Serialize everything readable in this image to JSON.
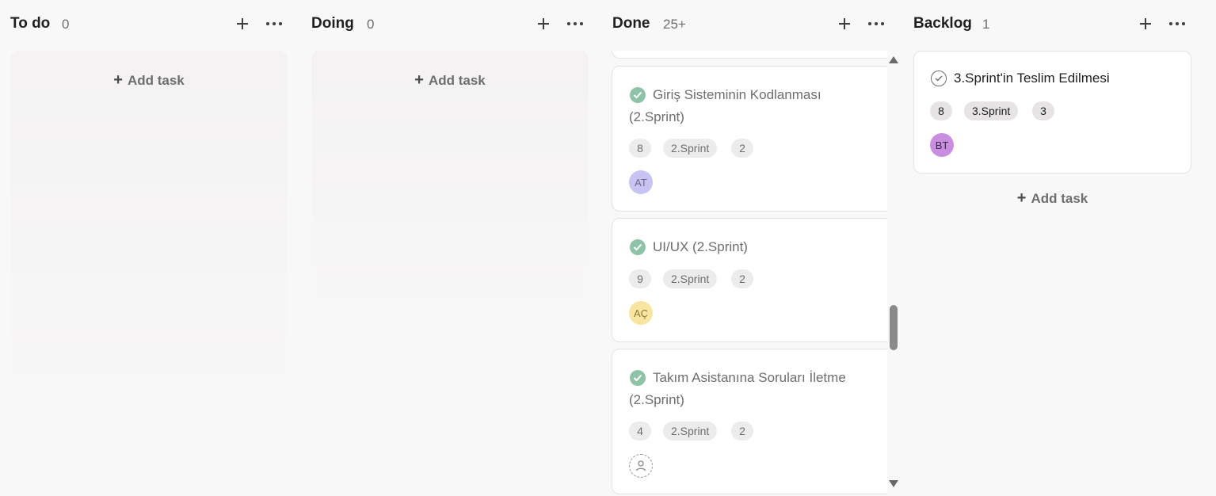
{
  "columns": [
    {
      "title": "To do",
      "count": "0",
      "add_task": "Add task"
    },
    {
      "title": "Doing",
      "count": "0",
      "add_task": "Add task"
    },
    {
      "title": "Done",
      "count": "25+"
    },
    {
      "title": "Backlog",
      "count": "1",
      "add_task": "Add task"
    }
  ],
  "done_cards": [
    {
      "title": "Giriş Sisteminin Kodlanması (2.Sprint)",
      "title_line1": "Giriş Sisteminin Kodlanması",
      "title_line2": "(2.Sprint)",
      "tags": [
        "8",
        "2.Sprint",
        "2"
      ],
      "assignee": "AT",
      "assignee_color": "#c7c3f2",
      "completed": true
    },
    {
      "title": "UI/UX (2.Sprint)",
      "tags": [
        "9",
        "2.Sprint",
        "2"
      ],
      "assignee": "AÇ",
      "assignee_color": "#f7e5a0",
      "completed": true
    },
    {
      "title": "Takım Asistanına Soruları İletme (2.Sprint)",
      "title_line1": "Takım Asistanına Soruları İletme",
      "title_line2": "(2.Sprint)",
      "tags": [
        "4",
        "2.Sprint",
        "2"
      ],
      "assignee": "",
      "completed": true
    }
  ],
  "backlog_cards": [
    {
      "title": "3.Sprint'in Teslim Edilmesi",
      "tags": [
        "8",
        "3.Sprint",
        "3"
      ],
      "assignee": "BT",
      "assignee_color": "#c98ee0",
      "completed": false
    }
  ],
  "icons": {
    "add": "plus-icon",
    "more": "more-horizontal-icon",
    "complete": "check-circle-icon",
    "unassigned": "user-placeholder-icon"
  },
  "colors": {
    "done_check": "#8fc3a7",
    "background": "#f9f8f8"
  }
}
